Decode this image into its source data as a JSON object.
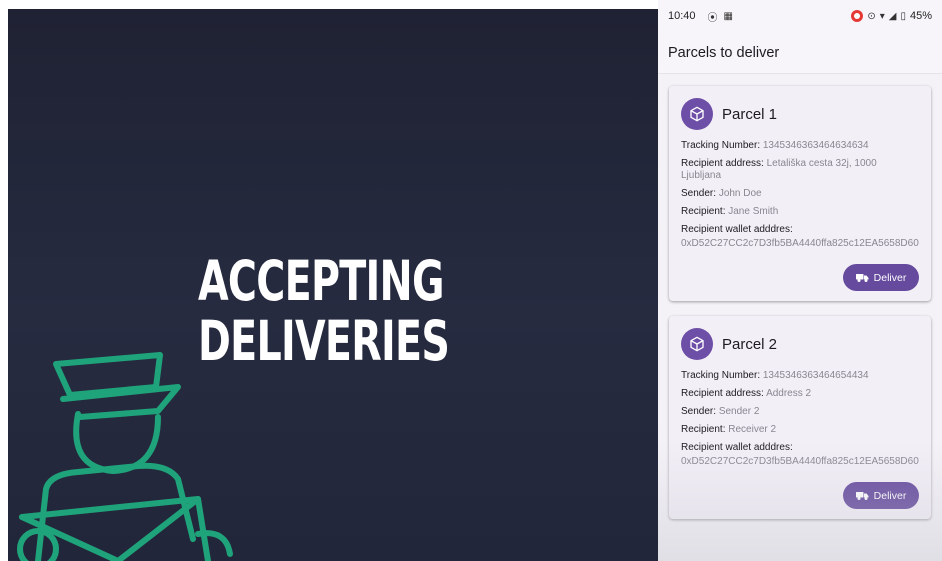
{
  "slide": {
    "title_line1": "ACCEPTING",
    "title_line2": "DELIVERIES",
    "courier_icon": "courier-with-envelope-illustration"
  },
  "statusbar": {
    "time": "10:40",
    "battery": "45%"
  },
  "appbar": {
    "title": "Parcels to deliver"
  },
  "labels": {
    "tracking": "Tracking Number: ",
    "address": "Recipient address: ",
    "sender": "Sender: ",
    "recipient": "Recipient: ",
    "wallet": "Recipient wallet adddres:",
    "deliver": "Deliver"
  },
  "parcels": [
    {
      "title": "Parcel 1",
      "tracking": "1345346363464634634",
      "address": "Letališka cesta 32j, 1000 Ljubljana",
      "sender": "John Doe",
      "recipient": "Jane Smith",
      "wallet": "0xD52C27CC2c7D3fb5BA4440ffa825c12EA5658D60"
    },
    {
      "title": "Parcel 2",
      "tracking": "1345346363464654434",
      "address": "Address 2",
      "sender": "Sender 2",
      "recipient": "Receiver 2",
      "wallet": "0xD52C27CC2c7D3fb5BA4440ffa825c12EA5658D60"
    }
  ],
  "colors": {
    "accent": "#654a9e",
    "slide_bg": "#22263a",
    "illustration": "#1fa37a"
  }
}
